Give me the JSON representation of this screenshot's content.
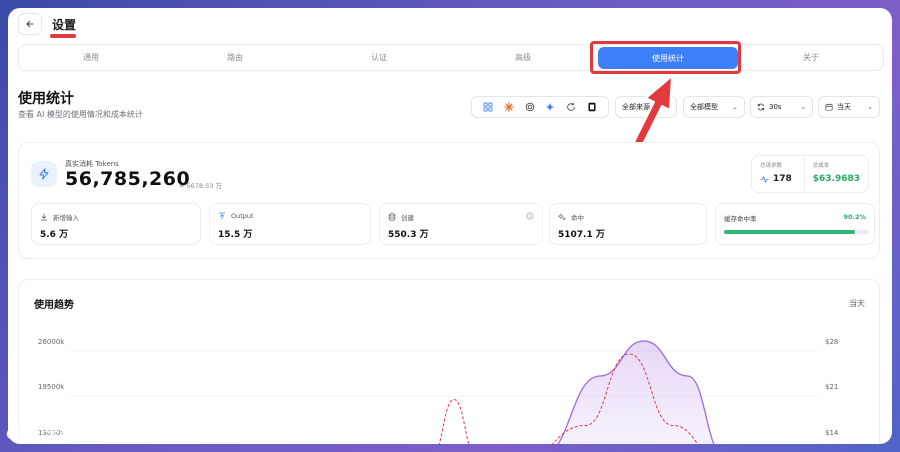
{
  "header": {
    "title": "设置"
  },
  "tabs": [
    {
      "label": "通用"
    },
    {
      "label": "路由"
    },
    {
      "label": "认证"
    },
    {
      "label": "高级"
    },
    {
      "label": "使用统计",
      "active": true
    },
    {
      "label": "关于"
    }
  ],
  "page": {
    "title": "使用统计",
    "subtitle": "查看 AI 模型的使用情况和成本统计"
  },
  "toolbar": {
    "providers": [
      "grid-icon",
      "sun-icon",
      "spiral-icon",
      "sparkle-icon",
      "refresh-circle-icon",
      "square-app-icon"
    ],
    "provider_select": "全部来源",
    "model_select": "全部模型",
    "refresh_interval": "30s",
    "date_range": "当天"
  },
  "summary": {
    "tokens_label": "真实消耗 Tokens",
    "tokens_value": "56,785,260",
    "tokens_approx": "≈ 5678.53 万",
    "total_requests_label": "总请求数",
    "total_requests_value": "178",
    "total_cost_label": "总成本",
    "total_cost_value": "$63.9683"
  },
  "stats": [
    {
      "label": "新增输入",
      "value": "5.6 万"
    },
    {
      "label": "Output",
      "value": "15.5 万"
    },
    {
      "label": "创建",
      "value": "550.3 万"
    },
    {
      "label": "命中",
      "value": "5107.1 万"
    }
  ],
  "cache": {
    "label": "缓存命中率",
    "value": "90.2%",
    "fraction": 0.902
  },
  "chart": {
    "title": "使用趋势",
    "range_label": "当天"
  },
  "chart_data": {
    "type": "area",
    "title": "使用趋势",
    "y_left_ticks": [
      "26000k",
      "19500k",
      "13000k"
    ],
    "y_right_ticks": [
      "$28",
      "$21",
      "$14"
    ],
    "series": [
      {
        "name": "tokens",
        "style": "area",
        "color": "#9b6de0",
        "x": [
          0,
          0.5,
          0.62,
          0.7,
          0.76,
          0.82,
          0.87,
          1
        ],
        "values": [
          0,
          2000,
          9000,
          21000,
          26000,
          21000,
          9000,
          0
        ]
      },
      {
        "name": "cost",
        "style": "dashed",
        "color": "#e0383e",
        "x": [
          0,
          0.44,
          0.47,
          0.5,
          0.53,
          0.56,
          0.6,
          0.68,
          0.74,
          0.8,
          0.86,
          1
        ],
        "values": [
          0,
          0,
          8,
          19,
          8,
          0,
          0,
          15,
          26,
          15,
          0,
          0
        ]
      }
    ]
  },
  "watermark": {
    "text": "大数跨境"
  }
}
